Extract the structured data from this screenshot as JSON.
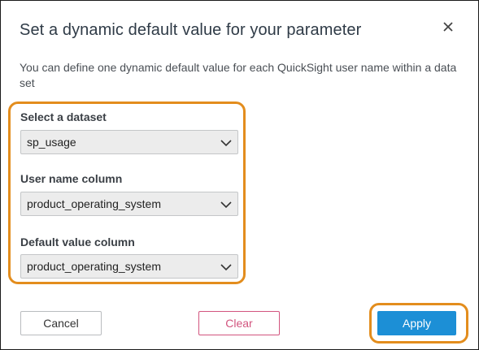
{
  "dialog": {
    "title": "Set a dynamic default value for your parameter",
    "description": "You can define one dynamic default value for each QuickSight user name within a data set"
  },
  "fields": {
    "dataset": {
      "label": "Select a dataset",
      "value": "sp_usage"
    },
    "username_column": {
      "label": "User name column",
      "value": "product_operating_system"
    },
    "default_value_column": {
      "label": "Default value column",
      "value": "product_operating_system"
    }
  },
  "buttons": {
    "cancel": "Cancel",
    "clear": "Clear",
    "apply": "Apply"
  },
  "icons": {
    "close": "close-icon",
    "dropdown": "chevron-down-icon"
  },
  "colors": {
    "highlight": "#e38d1d",
    "apply": "#1c8fd6",
    "clear": "#d2547e"
  }
}
